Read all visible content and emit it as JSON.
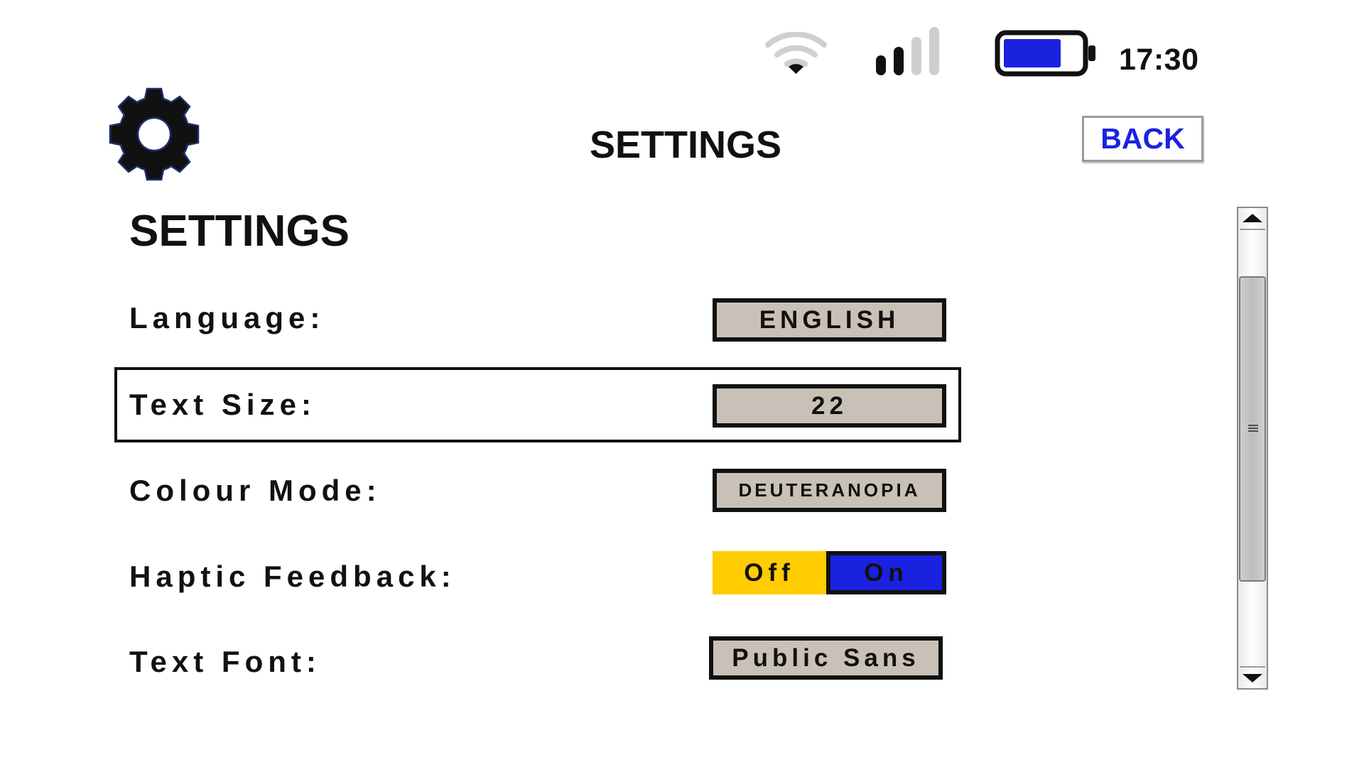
{
  "status_bar": {
    "time": "17:30",
    "wifi_icon": "wifi-icon",
    "signal_icon": "cellular-signal-icon",
    "battery_icon": "battery-icon",
    "battery_color": "#1a22e0"
  },
  "header": {
    "title": "SETTINGS",
    "back_label": "BACK",
    "gear_icon": "gear-icon"
  },
  "page": {
    "title": "SETTINGS"
  },
  "settings": {
    "language": {
      "label": "Language:",
      "value": "ENGLISH"
    },
    "text_size": {
      "label": "Text Size:",
      "value": "22"
    },
    "colour_mode": {
      "label": "Colour Mode:",
      "value": "DEUTERANOPIA"
    },
    "haptic_feedback": {
      "label": "Haptic Feedback:",
      "off_label": "Off",
      "on_label": "On",
      "selected": "On"
    },
    "text_font": {
      "label": "Text Font:",
      "value": "Public Sans"
    }
  },
  "colors": {
    "accent_blue": "#1a22e0",
    "toggle_yellow": "#ffcc00",
    "value_box_fill": "#c9c1b7",
    "text": "#111111"
  }
}
